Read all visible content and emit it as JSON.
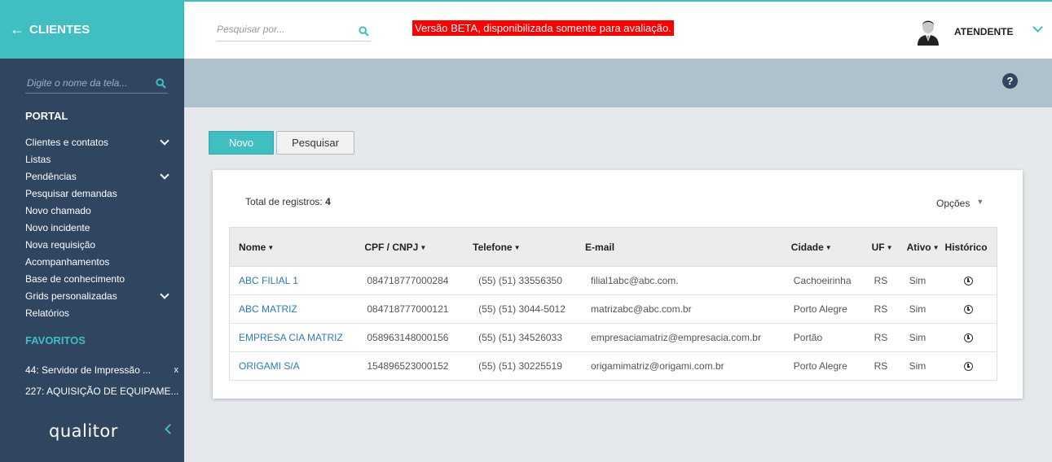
{
  "colors": {
    "accent": "#3fbfc2",
    "sidebar": "#2f4560",
    "beta_bg": "#ff0000",
    "link": "#2c7ab8"
  },
  "sidebar": {
    "header": "CLIENTES",
    "search_placeholder": "Digite o nome da tela...",
    "section_title": "PORTAL",
    "items": [
      {
        "label": "Clientes e contatos",
        "expandable": true
      },
      {
        "label": "Listas",
        "expandable": false
      },
      {
        "label": "Pendências",
        "expandable": true
      },
      {
        "label": "Pesquisar demandas",
        "expandable": false
      },
      {
        "label": "Novo chamado",
        "expandable": false
      },
      {
        "label": "Novo incidente",
        "expandable": false
      },
      {
        "label": "Nova requisição",
        "expandable": false
      },
      {
        "label": "Acompanhamentos",
        "expandable": false
      },
      {
        "label": "Base de conhecimento",
        "expandable": false
      },
      {
        "label": "Grids personalizadas",
        "expandable": true
      },
      {
        "label": "Relatórios",
        "expandable": false
      }
    ],
    "favorites_title": "FAVORITOS",
    "favorites": [
      {
        "label": "44: Servidor de Impressão ...",
        "remove": "x"
      },
      {
        "label": "227: AQUISIÇÃO DE EQUIPAME...",
        "remove": ""
      }
    ],
    "logo": "qualitor"
  },
  "topbar": {
    "search_placeholder": "Pesquisar por...",
    "beta_notice": "Versão BETA, disponibilizada somente para avaliação.",
    "user": "ATENDENTE"
  },
  "help_label": "?",
  "actions": {
    "new_label": "Novo",
    "search_label": "Pesquisar"
  },
  "panel": {
    "total_label": "Total de registros:",
    "total_count": "4",
    "options_label": "Opções"
  },
  "table": {
    "columns": [
      {
        "label": "Nome",
        "sortable": true
      },
      {
        "label": "CPF / CNPJ",
        "sortable": true
      },
      {
        "label": "Telefone",
        "sortable": true
      },
      {
        "label": "E-mail",
        "sortable": false
      },
      {
        "label": "Cidade",
        "sortable": true
      },
      {
        "label": "UF",
        "sortable": true
      },
      {
        "label": "Ativo",
        "sortable": true
      },
      {
        "label": "Histórico",
        "sortable": false
      }
    ],
    "rows": [
      {
        "nome": "ABC FILIAL 1",
        "cpf": "084718777000284",
        "telefone": "(55) (51) 33556350",
        "email": "filial1abc@abc.com.",
        "cidade": "Cachoeirinha",
        "uf": "RS",
        "ativo": "Sim"
      },
      {
        "nome": "ABC MATRIZ",
        "cpf": "084718777000121",
        "telefone": "(55) (51) 3044-5012",
        "email": "matrizabc@abc.com.br",
        "cidade": "Porto Alegre",
        "uf": "RS",
        "ativo": "Sim"
      },
      {
        "nome": "EMPRESA CIA MATRIZ",
        "cpf": "058963148000156",
        "telefone": "(55) (51) 34526033",
        "email": "empresaciamatriz@empresacia.com.br",
        "cidade": "Portão",
        "uf": "RS",
        "ativo": "Sim"
      },
      {
        "nome": "ORIGAMI S/A",
        "cpf": "154896523000152",
        "telefone": "(55) (51) 30225519",
        "email": "origamimatriz@origami.com.br",
        "cidade": "Porto Alegre",
        "uf": "RS",
        "ativo": "Sim"
      }
    ]
  }
}
